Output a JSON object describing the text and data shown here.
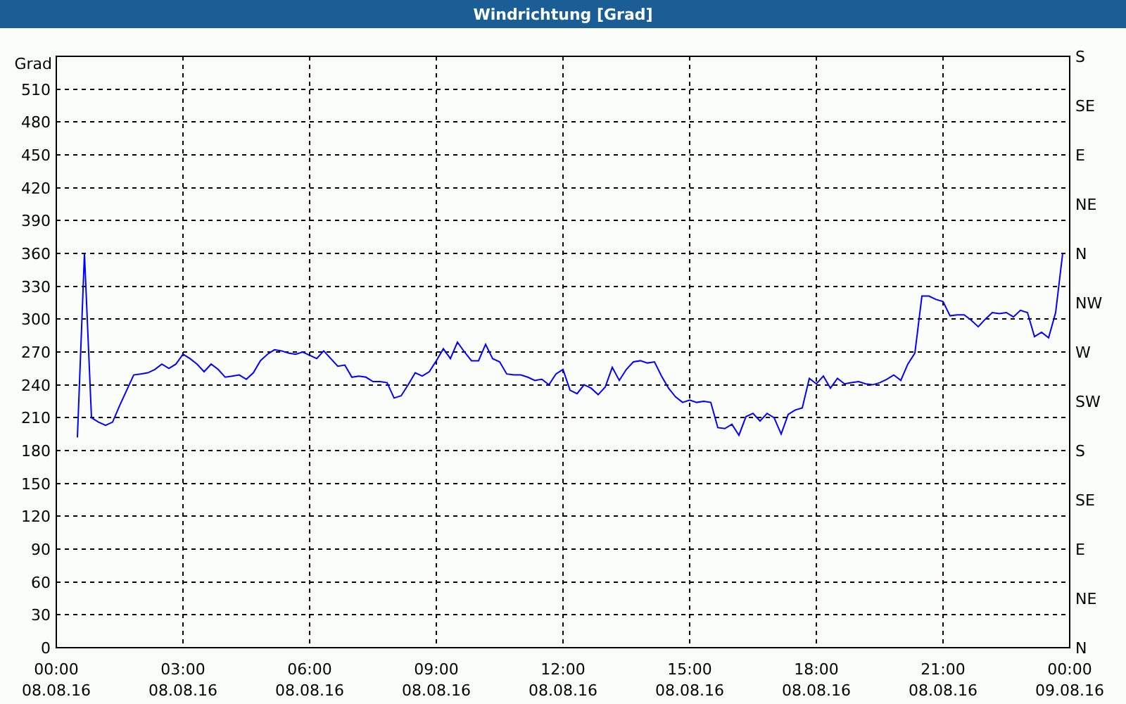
{
  "window": {
    "title": "Windrichtung [Grad]"
  },
  "chart": {
    "chart_data": {
      "type": "line",
      "ylabel": "Grad",
      "categories": [
        "00:00\n08.08.16",
        null,
        null,
        null,
        null,
        null,
        null,
        null,
        null,
        null,
        null,
        null,
        null,
        null,
        null,
        null,
        null,
        null,
        "03:00\n08.08.16",
        null,
        null,
        null,
        null,
        null,
        null,
        null,
        null,
        null,
        null,
        null,
        null,
        null,
        null,
        null,
        null,
        null,
        "06:00\n08.08.16",
        null,
        null,
        null,
        null,
        null,
        null,
        null,
        null,
        null,
        null,
        null,
        null,
        null,
        null,
        null,
        null,
        null,
        "09:00\n08.08.16",
        null,
        null,
        null,
        null,
        null,
        null,
        null,
        null,
        null,
        null,
        null,
        null,
        null,
        null,
        null,
        null,
        null,
        "12:00\n08.08.16",
        null,
        null,
        null,
        null,
        null,
        null,
        null,
        null,
        null,
        null,
        null,
        null,
        null,
        null,
        null,
        null,
        null,
        "15:00\n08.08.16",
        null,
        null,
        null,
        null,
        null,
        null,
        null,
        null,
        null,
        null,
        null,
        null,
        null,
        null,
        null,
        null,
        null,
        "18:00\n08.08.16",
        null,
        null,
        null,
        null,
        null,
        null,
        null,
        null,
        null,
        null,
        null,
        null,
        null,
        null,
        null,
        null,
        null,
        "21:00\n08.08.16",
        null,
        null,
        null,
        null,
        null,
        null,
        null,
        null,
        null,
        null,
        null,
        null,
        null,
        null,
        null,
        null,
        null,
        "00:00\n09.08.16"
      ],
      "series": [
        {
          "color": "#0000ff",
          "values": [
            null,
            null,
            null,
            192,
            360,
            210,
            206,
            203,
            206,
            221,
            235,
            249,
            250,
            251,
            254,
            259,
            255,
            259,
            268,
            264,
            259,
            252,
            259,
            254,
            247,
            248,
            249,
            245,
            251,
            262,
            268,
            272,
            271,
            269,
            268,
            270,
            267,
            264,
            271,
            264,
            257,
            258,
            247,
            248,
            247,
            243,
            243,
            242,
            228,
            230,
            240,
            251,
            248,
            252,
            262,
            273,
            264,
            279,
            270,
            262,
            262,
            277,
            264,
            261,
            250,
            249,
            249,
            247,
            244,
            245,
            240,
            250,
            254,
            235,
            232,
            240,
            237,
            231,
            238,
            256,
            244,
            254,
            261,
            262,
            260,
            261,
            248,
            237,
            229,
            224,
            226,
            224,
            225,
            224,
            201,
            200,
            204,
            194,
            211,
            214,
            207,
            214,
            210,
            195,
            213,
            217,
            219,
            246,
            241,
            248,
            237,
            246,
            241,
            242,
            243,
            241,
            240,
            242,
            245,
            249,
            244,
            259,
            269,
            321,
            321,
            318,
            316,
            303,
            304,
            304,
            299,
            293,
            300,
            306,
            305,
            306,
            302,
            308,
            306,
            284,
            288,
            283,
            306,
            360,
            null
          ]
        }
      ],
      "ylim": [
        0,
        540
      ],
      "grid": true,
      "yticks": [
        0,
        30,
        60,
        90,
        120,
        150,
        180,
        210,
        240,
        270,
        300,
        330,
        360,
        390,
        420,
        450,
        480,
        510
      ]
    },
    "compass_labels": [
      "S",
      "SE",
      "E",
      "NE",
      "N",
      "NW",
      "W",
      "SW",
      "S",
      "SE",
      "E",
      "NE",
      "N"
    ]
  }
}
